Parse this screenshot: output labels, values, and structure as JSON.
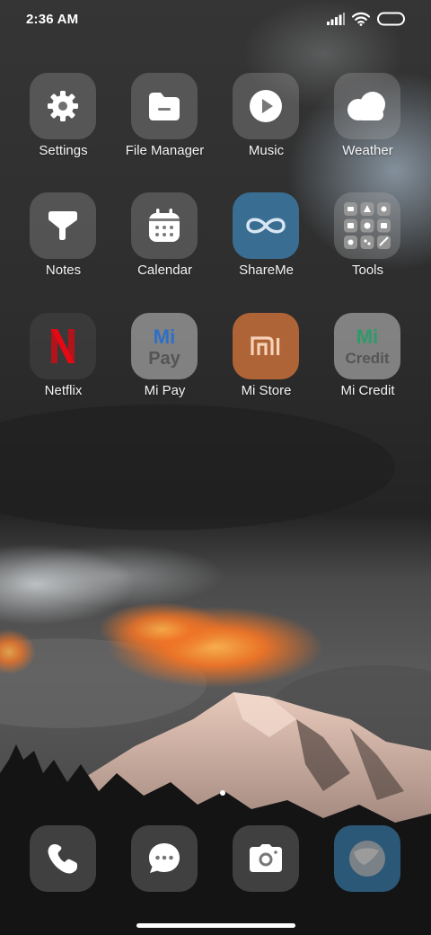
{
  "status_bar": {
    "time": "2:36 AM"
  },
  "apps": [
    {
      "label": "Settings",
      "icon": "gear-icon"
    },
    {
      "label": "File Manager",
      "icon": "folder-icon"
    },
    {
      "label": "Music",
      "icon": "play-icon"
    },
    {
      "label": "Weather",
      "icon": "cloud-icon"
    },
    {
      "label": "Notes",
      "icon": "notes-icon"
    },
    {
      "label": "Calendar",
      "icon": "calendar-icon"
    },
    {
      "label": "ShareMe",
      "icon": "infinity-icon"
    },
    {
      "label": "Tools",
      "icon": "tools-grid-icon"
    },
    {
      "label": "Netflix",
      "icon": "netflix-icon",
      "logo_text": "N"
    },
    {
      "label": "Mi Pay",
      "icon": "mi-pay-icon",
      "logo_text": "Pay"
    },
    {
      "label": "Mi Store",
      "icon": "mi-store-icon",
      "logo_text": "mi"
    },
    {
      "label": "Mi Credit",
      "icon": "mi-credit-icon",
      "logo_text": "Credit"
    }
  ],
  "dock": [
    {
      "icon": "phone-icon"
    },
    {
      "icon": "messages-icon"
    },
    {
      "icon": "camera-icon"
    },
    {
      "icon": "browser-icon"
    }
  ],
  "colors": {
    "sky_dark": "#2b2b2b",
    "fire_orange": "#ff7a2a",
    "shareme_blue": "#3f8fc8",
    "mi_store_orange": "#e07a3a",
    "netflix_red": "#b3141b",
    "mi_green": "#2e9a6a",
    "mi_blue": "#2d6fc9"
  },
  "page_indicator": {
    "current": 1,
    "total": 1
  }
}
